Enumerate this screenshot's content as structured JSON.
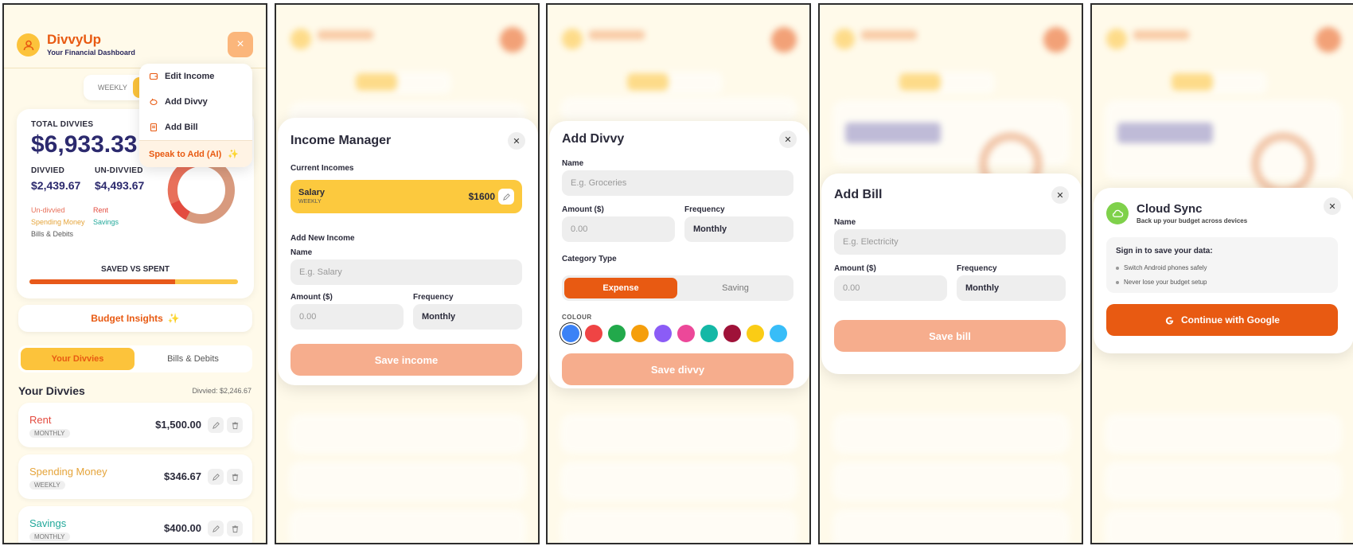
{
  "app": {
    "title": "DivvyUp",
    "subtitle": "Your Financial Dashboard"
  },
  "header": {
    "close_label": "×"
  },
  "period_toggle": {
    "weekly_label": "WEEKLY"
  },
  "menu": {
    "items": [
      {
        "label": "Edit Income",
        "icon": "wallet-icon"
      },
      {
        "label": "Add Divvy",
        "icon": "piggy-icon"
      },
      {
        "label": "Add Bill",
        "icon": "receipt-icon"
      }
    ],
    "ai_label": "Speak to Add (AI)"
  },
  "summary": {
    "total_label": "TOTAL DIVVIES",
    "total_value": "$6,933.33",
    "divvied_label": "DIVVIED",
    "divvied_value": "$2,439.67",
    "undivvied_label": "UN-DIVVIED",
    "undivvied_value": "$4,493.67",
    "legend": [
      {
        "label": "Un-divvied",
        "color": "#e8705a"
      },
      {
        "label": "Rent",
        "color": "#e34b3f"
      },
      {
        "label": "Spending Money",
        "color": "#e5a43a"
      },
      {
        "label": "Savings",
        "color": "#22a89a"
      },
      {
        "label": "Bills & Debits",
        "color": "#555555"
      }
    ],
    "saved_vs_spent_label": "SAVED VS SPENT",
    "spent_fraction": 0.7
  },
  "insights": {
    "label": "Budget Insights"
  },
  "tabs": {
    "divvies": "Your Divvies",
    "bills": "Bills & Debits"
  },
  "divvies": {
    "title": "Your Divvies",
    "meta": "Divvied: $2,246.67",
    "rows": [
      {
        "name": "Rent",
        "freq": "MONTHLY",
        "amount": "$1,500.00",
        "color": "#e34b3f"
      },
      {
        "name": "Spending Money",
        "freq": "WEEKLY",
        "amount": "$346.67",
        "color": "#e5a43a"
      },
      {
        "name": "Savings",
        "freq": "MONTHLY",
        "amount": "$400.00",
        "color": "#22a89a"
      }
    ]
  },
  "income_manager": {
    "title": "Income Manager",
    "current_label": "Current Incomes",
    "salary": {
      "name": "Salary",
      "freq": "WEEKLY",
      "amount": "$1600"
    },
    "add_new_label": "Add New Income",
    "name_label": "Name",
    "name_placeholder": "E.g. Salary",
    "amount_label": "Amount ($)",
    "amount_placeholder": "0.00",
    "frequency_label": "Frequency",
    "frequency_value": "Monthly",
    "save_label": "Save income"
  },
  "add_divvy": {
    "title": "Add Divvy",
    "name_label": "Name",
    "name_placeholder": "E.g. Groceries",
    "amount_label": "Amount ($)",
    "amount_placeholder": "0.00",
    "frequency_label": "Frequency",
    "frequency_value": "Monthly",
    "category_label": "Category Type",
    "expense_label": "Expense",
    "saving_label": "Saving",
    "colour_label": "COLOUR",
    "colours": [
      "#3b82f6",
      "#ef4444",
      "#22a94b",
      "#f59e0b",
      "#8b5cf6",
      "#ec4899",
      "#14b8a6",
      "#9f1239",
      "#facc15",
      "#38bdf8"
    ],
    "save_label": "Save divvy"
  },
  "add_bill": {
    "title": "Add Bill",
    "name_label": "Name",
    "name_placeholder": "E.g. Electricity",
    "amount_label": "Amount ($)",
    "amount_placeholder": "0.00",
    "frequency_label": "Frequency",
    "frequency_value": "Monthly",
    "save_label": "Save bill"
  },
  "cloud_sync": {
    "title": "Cloud Sync",
    "subtitle": "Back up your budget across devices",
    "box_heading": "Sign in to save your data:",
    "bullets": [
      "Switch Android phones safely",
      "Never lose your budget setup"
    ],
    "google_label": "Continue with Google"
  },
  "colors": {
    "accent": "#e85a12",
    "yellow": "#fcc33b",
    "navy": "#2c2a6e",
    "background": "#fffaea"
  }
}
